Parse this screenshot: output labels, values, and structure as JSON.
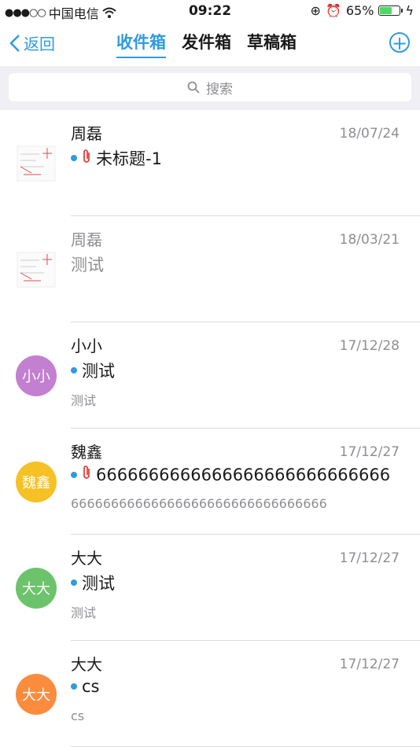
{
  "status": {
    "carrier": "中国电信",
    "time": "09:22",
    "battery_pct": "65%",
    "battery_level": 0.65
  },
  "nav": {
    "back_label": "返回",
    "tabs": [
      "收件箱",
      "发件箱",
      "草稿箱"
    ],
    "active_tab": 0
  },
  "search": {
    "placeholder": "搜索"
  },
  "emails": [
    {
      "sender": "周磊",
      "date": "18/07/24",
      "subject": "未标题-1",
      "preview": "",
      "unread": true,
      "attachment": true,
      "avatar": "thumbnail"
    },
    {
      "sender": "周磊",
      "date": "18/03/21",
      "subject": "测试",
      "preview": "",
      "unread": false,
      "attachment": false,
      "avatar": "thumbnail"
    },
    {
      "sender": "小小",
      "date": "17/12/28",
      "subject": "测试",
      "preview": "测试",
      "unread": true,
      "attachment": false,
      "avatar": "小小",
      "avatar_color": "#c37fd0"
    },
    {
      "sender": "魏鑫",
      "date": "17/12/27",
      "subject": "6666666666666666666666666666",
      "preview": "66666666666666666666666666666666",
      "unread": true,
      "attachment": true,
      "avatar": "魏鑫",
      "avatar_color": "#f6c125"
    },
    {
      "sender": "大大",
      "date": "17/12/27",
      "subject": "测试",
      "preview": "测试",
      "unread": true,
      "attachment": false,
      "avatar": "大大",
      "avatar_color": "#6cc36b"
    },
    {
      "sender": "大大",
      "date": "17/12/27",
      "subject": "cs",
      "preview": "cs",
      "unread": true,
      "attachment": false,
      "avatar": "大大",
      "avatar_color": "#fb8c3e"
    }
  ]
}
